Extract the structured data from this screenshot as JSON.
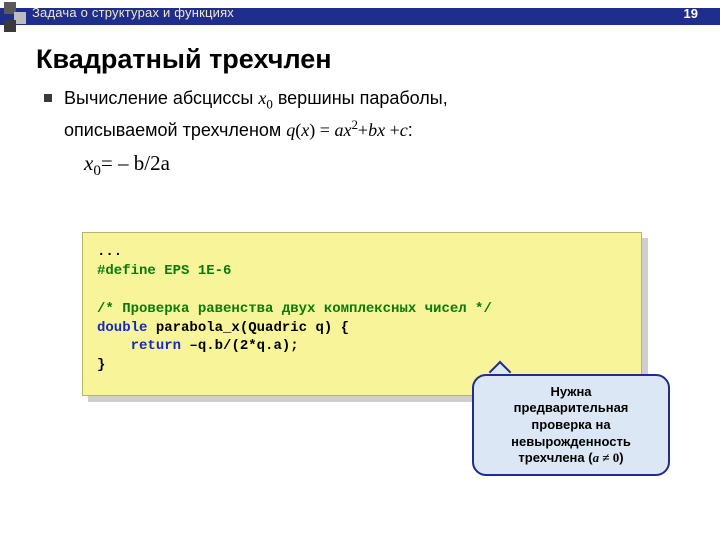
{
  "header": {
    "breadcrumb": "Задача о структурах и функциях",
    "page_number": "19"
  },
  "title": "Квадратный трехчлен",
  "bullet": {
    "line1_pre": "Вычисление абсциссы ",
    "line1_x": "x",
    "line1_sub": "0",
    "line1_mid": " вершины параболы,",
    "line2_pre": "описываемой трехчленом ",
    "line2_q": "q",
    "line2_paren_open": "(",
    "line2_x": "x",
    "line2_paren_close": ") = ",
    "line2_a": "a",
    "line2_xx": "x",
    "line2_sq": "2",
    "line2_plus1": "+",
    "line2_b": "b",
    "line2_x2": "x",
    "line2_plus2": " +",
    "line2_c": "c",
    "line2_colon": ":",
    "eq_x": "x",
    "eq_sub": "0",
    "eq_mid": "=  – b/2a"
  },
  "code": {
    "l1": "...",
    "l2": "#define EPS 1E-6",
    "l3": "",
    "l4": "/* Проверка равенства двух комплексных чисел */",
    "l5a": "double",
    "l5b": " parabola_x(Quadric q) {",
    "l6a": "    ",
    "l6b": "return",
    "l6c": " –q.b/(2*q.a);",
    "l7": "}"
  },
  "callout": {
    "t1": "Нужна",
    "t2": "предварительная",
    "t3": "проверка на",
    "t4": "невырожденность",
    "t5_pre": "трехчлена (",
    "t5_a": "a",
    "t5_ne": " ≠ 0",
    "t5_close": ")"
  }
}
